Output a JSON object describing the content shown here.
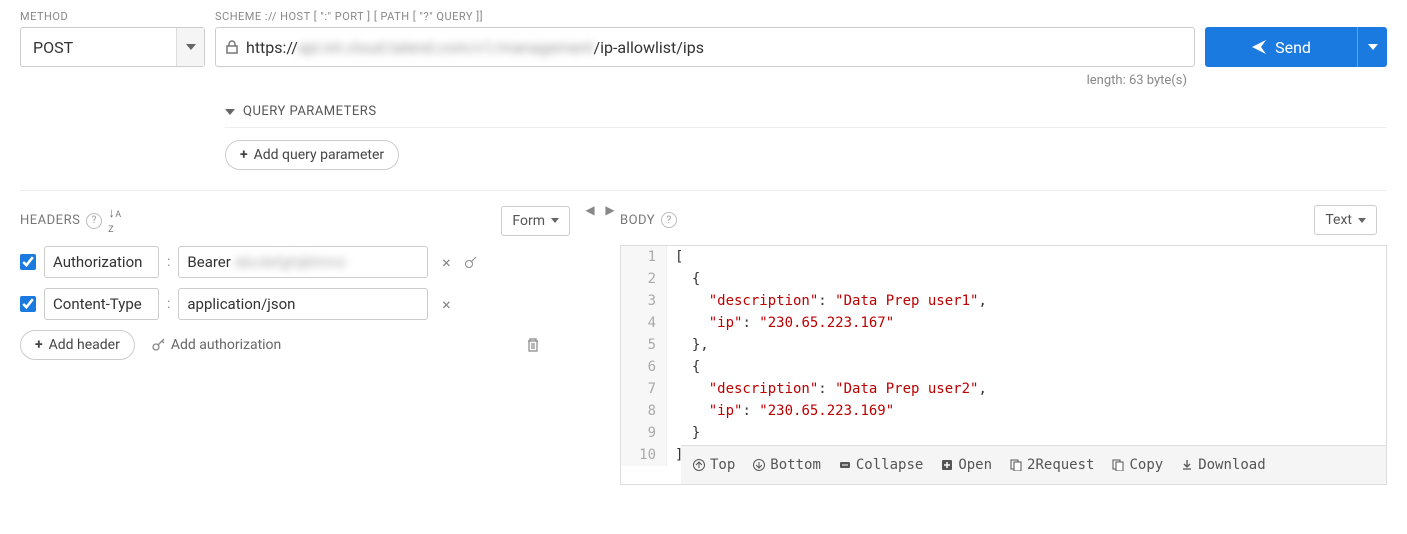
{
  "labels": {
    "method": "METHOD",
    "scheme": "SCHEME :// HOST [ \":\" PORT ] [ PATH [ \"?\" QUERY ]]",
    "headers": "HEADERS",
    "body": "BODY"
  },
  "method": {
    "value": "POST"
  },
  "url": {
    "prefix": "https://",
    "blurred": "api.int.cloud.talend.com/v1/management",
    "suffix": "/ip-allowlist/ips"
  },
  "send": {
    "label": "Send"
  },
  "length_info": "length: 63 byte(s)",
  "query": {
    "title": "QUERY PARAMETERS",
    "add_btn": "Add query parameter"
  },
  "headers_panel": {
    "form_label": "Form",
    "rows": [
      {
        "enabled": true,
        "name": "Authorization",
        "value_prefix": "Bearer ",
        "value_blurred": "abcdefghijklmno",
        "wand": true
      },
      {
        "enabled": true,
        "name": "Content-Type",
        "value_prefix": "application/json",
        "value_blurred": "",
        "wand": false
      }
    ],
    "add_header": "Add header",
    "add_auth": "Add authorization"
  },
  "body_panel": {
    "text_label": "Text",
    "code_lines": [
      "[",
      "  {",
      "    \"description\": \"Data Prep user1\",",
      "    \"ip\": \"230.65.223.167\"",
      "  },",
      "  {",
      "    \"description\": \"Data Prep user2\",",
      "    \"ip\": \"230.65.223.169\"",
      "  }",
      "]"
    ],
    "toolbar": {
      "top": "Top",
      "bottom": "Bottom",
      "collapse": "Collapse",
      "open": "Open",
      "to_request": "2Request",
      "copy": "Copy",
      "download": "Download"
    }
  }
}
